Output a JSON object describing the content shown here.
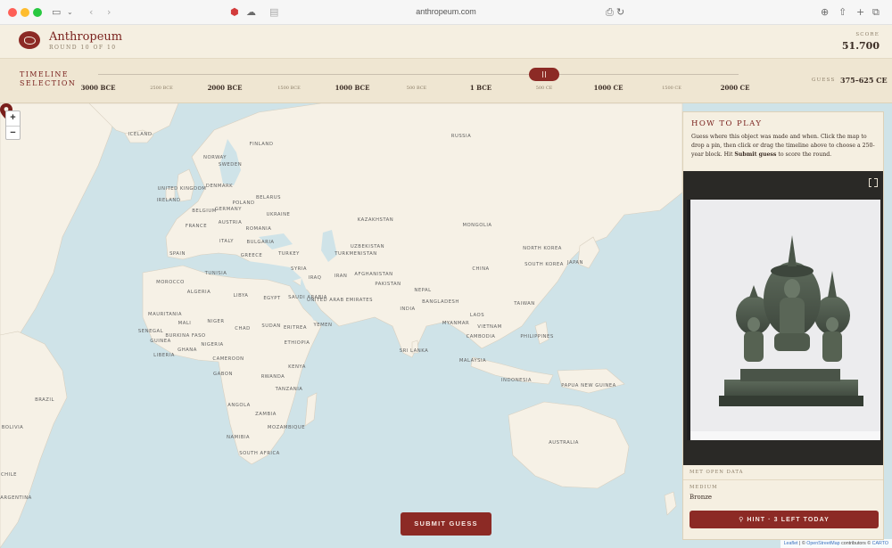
{
  "browser": {
    "url": "anthropeum.com",
    "icons": [
      "sidebar-icon",
      "chevron-down-icon",
      "back-icon",
      "forward-icon",
      "shield-icon",
      "cloud-icon",
      "reader-icon",
      "translate-icon",
      "reload-icon",
      "download-icon",
      "share-icon",
      "new-tab-icon",
      "tabs-icon"
    ]
  },
  "header": {
    "brand": "Anthropeum",
    "round": "ROUND 10 OF 10",
    "score_label": "SCORE",
    "score_value": "51.700"
  },
  "timeline": {
    "label_line1": "TIMELINE",
    "label_line2": "SELECTION",
    "ticks_major": [
      "3000 BCE",
      "2000 BCE",
      "1000 BCE",
      "1 BCE",
      "1000 CE",
      "2000 CE"
    ],
    "ticks_minor": [
      "2500 BCE",
      "1500 BCE",
      "500 BCE",
      "500 CE",
      "1500 CE"
    ],
    "guess_label": "GUESS",
    "guess_value": "375–625 CE"
  },
  "map": {
    "zoom_in": "+",
    "zoom_out": "−",
    "labels": [
      "ICELAND",
      "FINLAND",
      "NORWAY",
      "SWEDEN",
      "RUSSIA",
      "DENMARK",
      "UNITED KINGDOM",
      "IRELAND",
      "POLAND",
      "BELARUS",
      "GERMANY",
      "BELGIUM",
      "UKRAINE",
      "FRANCE",
      "AUSTRIA",
      "ROMANIA",
      "KAZAKHSTAN",
      "MONGOLIA",
      "ITALY",
      "BULGARIA",
      "SPAIN",
      "GREECE",
      "TURKEY",
      "UZBEKISTAN",
      "TURKMENISTAN",
      "NORTH KOREA",
      "SOUTH KOREA",
      "JAPAN",
      "TUNISIA",
      "SYRIA",
      "IRAQ",
      "IRAN",
      "AFGHANISTAN",
      "CHINA",
      "MOROCCO",
      "ALGERIA",
      "LIBYA",
      "EGYPT",
      "SAUDI ARABIA",
      "UNITED ARAB EMIRATES",
      "PAKISTAN",
      "NEPAL",
      "INDIA",
      "BANGLADESH",
      "TAIWAN",
      "MAURITANIA",
      "MALI",
      "NIGER",
      "CHAD",
      "SUDAN",
      "ERITREA",
      "YEMEN",
      "MYANMAR",
      "LAOS",
      "VIETNAM",
      "SENEGAL",
      "GUINEA",
      "BURKINA FASO",
      "NIGERIA",
      "ETHIOPIA",
      "CAMBODIA",
      "PHILIPPINES",
      "LIBERIA",
      "GHANA",
      "CAMEROON",
      "GABON",
      "KENYA",
      "SRI LANKA",
      "MALAYSIA",
      "RWANDA",
      "TANZANIA",
      "INDONESIA",
      "PAPUA NEW GUINEA",
      "ANGOLA",
      "ZAMBIA",
      "NAMIBIA",
      "MOZAMBIQUE",
      "SOUTH AFRICA",
      "AUSTRALIA",
      "BRAZIL",
      "BOLIVIA",
      "CHILE",
      "ARGENTINA",
      "CUBA",
      "GUYANA",
      "COLOMBIA",
      "PERU"
    ],
    "attribution_leaflet": "Leaflet",
    "attribution_osm": "OpenStreetMap",
    "attribution_contrib": "contributors ©",
    "attribution_carto": "CARTO",
    "colors": {
      "water": "#cfe3e8",
      "land": "#f6f1e6",
      "pin": "#7a1f1b"
    }
  },
  "submit_label": "SUBMIT GUESS",
  "panel": {
    "title": "HOW TO PLAY",
    "text_1": "Guess where this object was made and when. Click the map to drop a pin, then click or drag the timeline above to choose a 250-year block. Hit ",
    "text_bold": "Submit guess",
    "text_2": " to score the round.",
    "source": "MET OPEN DATA",
    "medium_label": "MEDIUM",
    "medium_value": "Bronze",
    "hint_label": "HINT · 3 LEFT TODAY"
  }
}
